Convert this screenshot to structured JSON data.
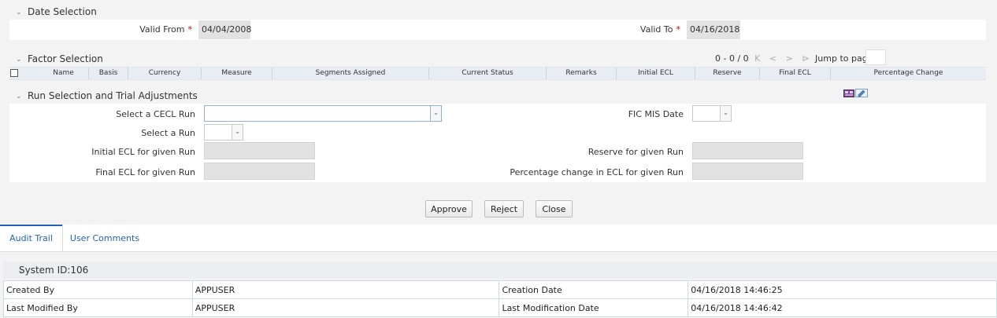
{
  "date_selection": {
    "title": "Date Selection",
    "valid_from_label": "Valid From",
    "valid_from_value": "04/04/2008",
    "valid_to_label": "Valid To",
    "valid_to_value": "04/16/2018",
    "required_mark": "*"
  },
  "factor_selection": {
    "title": "Factor Selection",
    "pager": {
      "range": "0 - 0 / 0",
      "first": "K",
      "prev": "<",
      "next": ">",
      "last": "⊳",
      "jump_label": "Jump to page"
    },
    "columns": [
      "Name",
      "Basis",
      "Currency",
      "Measure",
      "Segments Assigned",
      "Current Status",
      "Remarks",
      "Initial ECL",
      "Reserve",
      "Final ECL",
      "Percentage Change"
    ]
  },
  "run_selection": {
    "title": "Run Selection and Trial Adjustments",
    "select_cecl_run_label": "Select a CECL Run",
    "select_cecl_run_value": "",
    "fic_mis_date_label": "FIC MIS Date",
    "fic_mis_date_value": "",
    "select_run_label": "Select a Run",
    "select_run_value": "",
    "initial_ecl_label": "Initial ECL for given Run",
    "reserve_label": "Reserve for given Run",
    "final_ecl_label": "Final ECL for given Run",
    "percentage_change_label": "Percentage change in ECL for given Run"
  },
  "buttons": {
    "approve": "Approve",
    "reject": "Reject",
    "close": "Close"
  },
  "tabs": [
    {
      "label": "Audit Trail",
      "active": true
    },
    {
      "label": "User Comments",
      "active": false
    }
  ],
  "audit": {
    "system_id": "System ID:106",
    "rows": [
      {
        "label1": "Created By",
        "value1": "APPUSER",
        "label2": "Creation Date",
        "value2": "04/16/2018 14:46:25"
      },
      {
        "label1": "Last Modified By",
        "value1": "APPUSER",
        "label2": "Last Modification Date",
        "value2": "04/16/2018 14:46:42"
      }
    ]
  },
  "colors": {
    "accent": "#1f62b8",
    "required": "#cc0000",
    "grid_header": "#e8edf3",
    "readonly": "#e2e2e2"
  },
  "icons": [
    "chevron-down-icon",
    "dropdown-arrow-icon",
    "pager-first-icon",
    "pager-prev-icon",
    "pager-next-icon",
    "pager-last-icon",
    "group-icon",
    "edit-icon"
  ]
}
